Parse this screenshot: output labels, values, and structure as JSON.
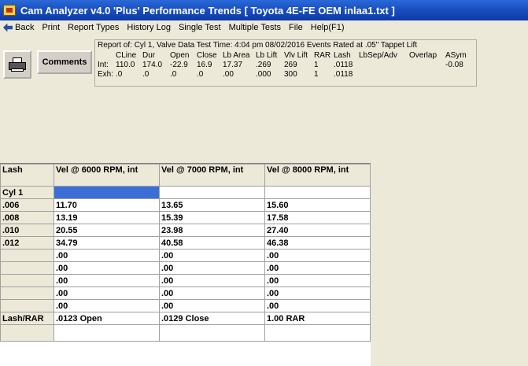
{
  "window": {
    "title": "Cam Analyzer v4.0 'Plus'  Performance Trends   [ Toyota 4E-FE OEM inlaa1.txt ]"
  },
  "menu": [
    "Back",
    "Print",
    "Report Types",
    "History Log",
    "Single Test",
    "Multiple Tests",
    "File",
    "Help(F1)"
  ],
  "toolbar": {
    "comments_label": "Comments"
  },
  "report": {
    "line1": "Report of:  Cyl 1, Valve Data     Test Time: 4:04 pm  08/02/2016     Events Rated at .05\" Tappet Lift",
    "headers": [
      "CLine",
      "Dur",
      "Open",
      "Close",
      "Lb Area",
      "Lb Lift",
      "Vlv Lift",
      "RAR",
      "Lash",
      "LbSep/Adv",
      "Overlap",
      "ASym"
    ],
    "int_label": "Int:",
    "int": [
      "110.0",
      "174.0",
      "-22.9",
      "16.9",
      "17.37",
      ".269",
      "269",
      "1",
      ".0118",
      "",
      "",
      "-0.08"
    ],
    "exh_label": "Exh:",
    "exh": [
      ".0",
      ".0",
      ".0",
      ".0",
      ".00",
      ".000",
      "300",
      "1",
      ".0118",
      "",
      "",
      ""
    ]
  },
  "grid": {
    "columns": [
      "Lash",
      "Vel @ 6000 RPM, int",
      "Vel @ 7000 RPM, int",
      "Vel @ 8000 RPM, int"
    ],
    "rows": [
      [
        "Cyl 1",
        "",
        "",
        ""
      ],
      [
        ".006",
        "11.70",
        "13.65",
        "15.60"
      ],
      [
        ".008",
        "13.19",
        "15.39",
        "17.58"
      ],
      [
        ".010",
        "20.55",
        "23.98",
        "27.40"
      ],
      [
        ".012",
        "34.79",
        "40.58",
        "46.38"
      ],
      [
        "",
        ".00",
        ".00",
        ".00"
      ],
      [
        "",
        ".00",
        ".00",
        ".00"
      ],
      [
        "",
        ".00",
        ".00",
        ".00"
      ],
      [
        "",
        ".00",
        ".00",
        ".00"
      ],
      [
        "",
        ".00",
        ".00",
        ".00"
      ],
      [
        "Lash/RAR",
        ".0123 Open",
        ".0129 Close",
        "1.00 RAR"
      ],
      [
        "",
        "",
        "",
        ""
      ]
    ]
  }
}
